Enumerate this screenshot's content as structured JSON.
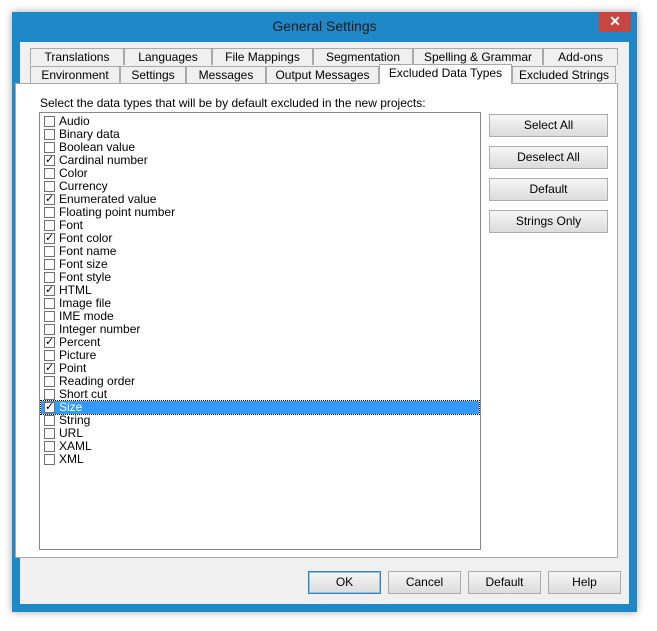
{
  "window": {
    "title": "General Settings",
    "close_glyph": "✕"
  },
  "tabs": {
    "row_top": [
      "Translations",
      "Languages",
      "File Mappings",
      "Segmentation",
      "Spelling & Grammar",
      "Add-ons"
    ],
    "row_bottom": [
      "Environment",
      "Settings",
      "Messages",
      "Output Messages",
      "Excluded Data Types",
      "Excluded Strings"
    ],
    "active": "Excluded Data Types"
  },
  "panel": {
    "instruction": "Select the data types that will be by default excluded in the new projects:",
    "items": [
      {
        "label": "Audio",
        "checked": false
      },
      {
        "label": "Binary data",
        "checked": false
      },
      {
        "label": "Boolean value",
        "checked": false
      },
      {
        "label": "Cardinal number",
        "checked": true
      },
      {
        "label": "Color",
        "checked": false
      },
      {
        "label": "Currency",
        "checked": false
      },
      {
        "label": "Enumerated value",
        "checked": true
      },
      {
        "label": "Floating point number",
        "checked": false
      },
      {
        "label": "Font",
        "checked": false
      },
      {
        "label": "Font color",
        "checked": true
      },
      {
        "label": "Font name",
        "checked": false
      },
      {
        "label": "Font size",
        "checked": false
      },
      {
        "label": "Font style",
        "checked": false
      },
      {
        "label": "HTML",
        "checked": true
      },
      {
        "label": "Image file",
        "checked": false
      },
      {
        "label": "IME mode",
        "checked": false
      },
      {
        "label": "Integer number",
        "checked": false
      },
      {
        "label": "Percent",
        "checked": true
      },
      {
        "label": "Picture",
        "checked": false
      },
      {
        "label": "Point",
        "checked": true
      },
      {
        "label": "Reading order",
        "checked": false
      },
      {
        "label": "Short cut",
        "checked": false
      },
      {
        "label": "Size",
        "checked": true,
        "selected": true
      },
      {
        "label": "String",
        "checked": false
      },
      {
        "label": "URL",
        "checked": false
      },
      {
        "label": "XAML",
        "checked": false
      },
      {
        "label": "XML",
        "checked": false
      }
    ],
    "buttons": {
      "select_all": "Select All",
      "deselect_all": "Deselect All",
      "default": "Default",
      "strings_only": "Strings Only"
    }
  },
  "footer": {
    "ok": "OK",
    "cancel": "Cancel",
    "default": "Default",
    "help": "Help"
  },
  "colors": {
    "frame": "#1e88c8",
    "close": "#c7463f",
    "selection": "#3399ff"
  }
}
